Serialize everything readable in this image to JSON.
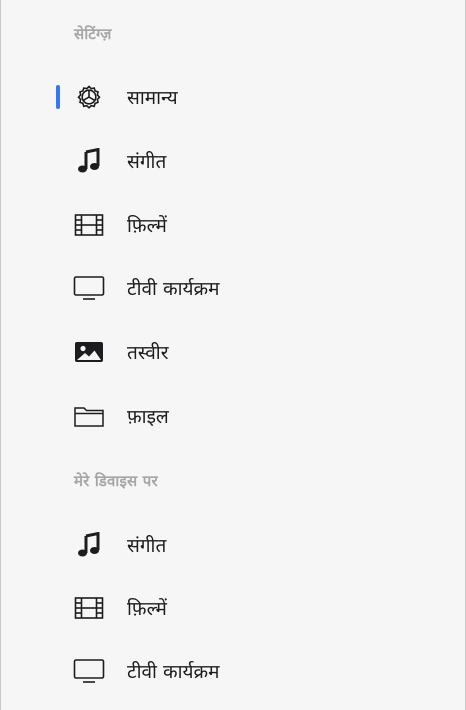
{
  "sidebar": {
    "section_settings": {
      "header": "सेटिंग्ज़",
      "items": [
        {
          "label": "सामान्य",
          "icon": "gear-icon",
          "selected": true
        },
        {
          "label": "संगीत",
          "icon": "music-note-icon",
          "selected": false
        },
        {
          "label": "फ़िल्में",
          "icon": "film-icon",
          "selected": false
        },
        {
          "label": "टीवी कार्यक्रम",
          "icon": "tv-icon",
          "selected": false
        },
        {
          "label": "तस्वीर",
          "icon": "photo-icon",
          "selected": false
        },
        {
          "label": "फ़ाइल",
          "icon": "folder-icon",
          "selected": false
        }
      ]
    },
    "section_devices": {
      "header": "मेरे डिवाइस पर",
      "items": [
        {
          "label": "संगीत",
          "icon": "music-note-icon"
        },
        {
          "label": "फ़िल्में",
          "icon": "film-icon"
        },
        {
          "label": "टीवी कार्यक्रम",
          "icon": "tv-icon"
        }
      ]
    }
  },
  "colors": {
    "accent": "#3478f6",
    "header_text": "#a6a6a6",
    "label_text": "#1d1d1f",
    "background": "#f6f6f6"
  }
}
